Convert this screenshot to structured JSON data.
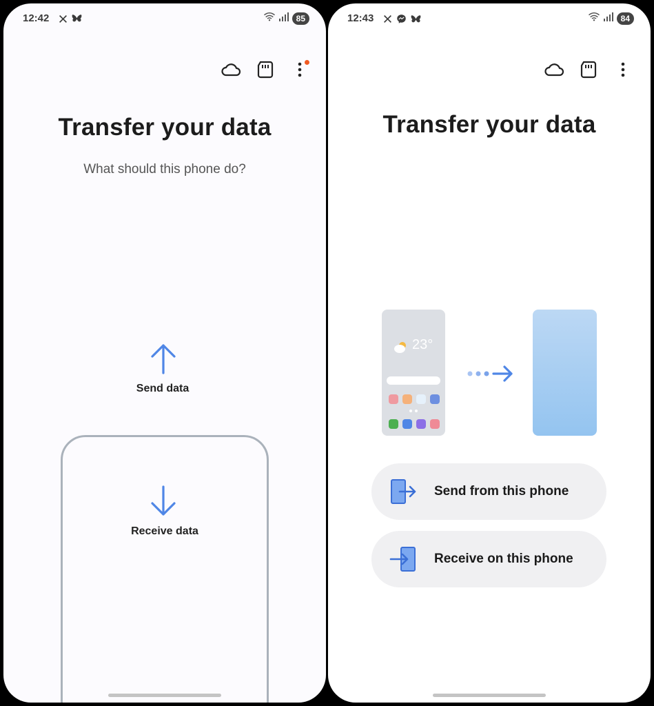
{
  "left": {
    "status": {
      "time": "12:42",
      "battery": "85"
    },
    "title": "Transfer your data",
    "subtitle": "What should this phone do?",
    "send_label": "Send data",
    "receive_label": "Receive data"
  },
  "right": {
    "status": {
      "time": "12:43",
      "battery": "84"
    },
    "title": "Transfer your data",
    "illustration": {
      "temperature": "23°"
    },
    "send_button": "Send from this phone",
    "receive_button": "Receive on this phone"
  },
  "colors": {
    "accent": "#4f86e6",
    "notification_dot": "#f05a22",
    "button_bg": "#f0f0f2",
    "frame_border": "#aab2bb"
  },
  "icons": [
    "x-icon",
    "butterfly-icon",
    "messenger-icon",
    "wifi-icon",
    "signal-icon",
    "cloud-icon",
    "sd-card-icon",
    "more-vert-icon",
    "arrow-up-icon",
    "arrow-down-icon",
    "send-phone-icon",
    "receive-phone-icon"
  ]
}
